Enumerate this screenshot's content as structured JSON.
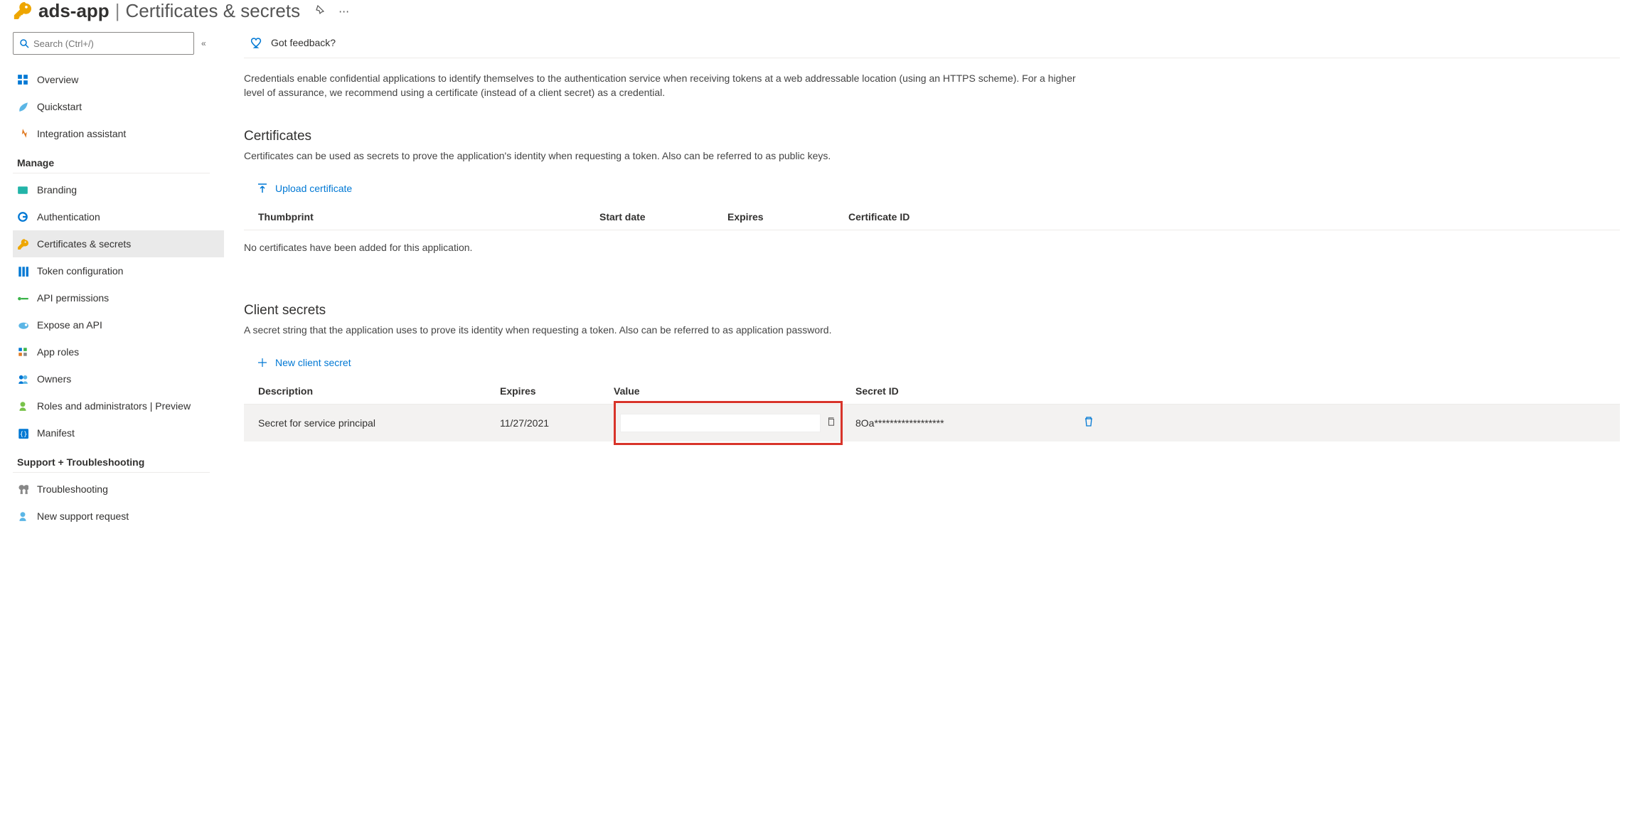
{
  "header": {
    "app_name": "ads-app",
    "section_name": "Certificates & secrets"
  },
  "search": {
    "placeholder": "Search (Ctrl+/)"
  },
  "sidebar": {
    "items_top": [
      {
        "label": "Overview",
        "icon": "overview"
      },
      {
        "label": "Quickstart",
        "icon": "quickstart"
      },
      {
        "label": "Integration assistant",
        "icon": "integration"
      }
    ],
    "manage_heading": "Manage",
    "items_manage": [
      {
        "label": "Branding",
        "icon": "branding"
      },
      {
        "label": "Authentication",
        "icon": "auth"
      },
      {
        "label": "Certificates & secrets",
        "icon": "key",
        "selected": true
      },
      {
        "label": "Token configuration",
        "icon": "token"
      },
      {
        "label": "API permissions",
        "icon": "apiperm"
      },
      {
        "label": "Expose an API",
        "icon": "expose"
      },
      {
        "label": "App roles",
        "icon": "approles"
      },
      {
        "label": "Owners",
        "icon": "owners"
      },
      {
        "label": "Roles and administrators | Preview",
        "icon": "roles"
      },
      {
        "label": "Manifest",
        "icon": "manifest"
      }
    ],
    "support_heading": "Support + Troubleshooting",
    "items_support": [
      {
        "label": "Troubleshooting",
        "icon": "troubleshoot"
      },
      {
        "label": "New support request",
        "icon": "support"
      }
    ]
  },
  "feedback": {
    "label": "Got feedback?"
  },
  "intro": "Credentials enable confidential applications to identify themselves to the authentication service when receiving tokens at a web addressable location (using an HTTPS scheme). For a higher level of assurance, we recommend using a certificate (instead of a client secret) as a credential.",
  "certificates": {
    "title": "Certificates",
    "desc": "Certificates can be used as secrets to prove the application's identity when requesting a token. Also can be referred to as public keys.",
    "upload_label": "Upload certificate",
    "columns": {
      "thumbprint": "Thumbprint",
      "start": "Start date",
      "expires": "Expires",
      "id": "Certificate ID"
    },
    "empty": "No certificates have been added for this application."
  },
  "secrets": {
    "title": "Client secrets",
    "desc": "A secret string that the application uses to prove its identity when requesting a token. Also can be referred to as application password.",
    "new_label": "New client secret",
    "columns": {
      "description": "Description",
      "expires": "Expires",
      "value": "Value",
      "secret_id": "Secret ID"
    },
    "rows": [
      {
        "description": "Secret for service principal",
        "expires": "11/27/2021",
        "value": "",
        "secret_id": "8Oa******************"
      }
    ]
  }
}
